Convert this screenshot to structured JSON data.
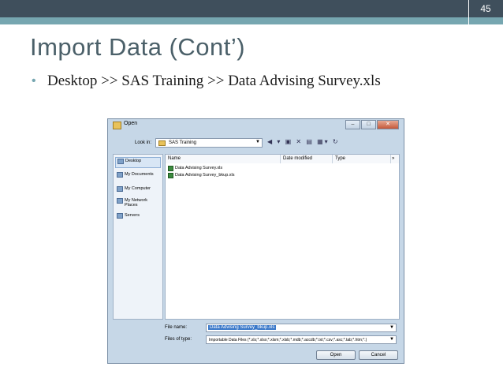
{
  "slide": {
    "page_number": "45",
    "title": "Import Data (Cont’)",
    "bullet": "Desktop >> SAS Training >> Data Advising Survey.xls"
  },
  "dialog": {
    "title": "Open",
    "look_in_label": "Look in:",
    "look_in_value": "SAS Training",
    "places": [
      "Desktop",
      "My Documents",
      "My Computer",
      "My Network Places",
      "Servers"
    ],
    "columns": [
      "Name",
      "Date modified",
      "Type"
    ],
    "files": [
      "Data Advising Survey.xls",
      "Data Advising Survey_bkup.xls"
    ],
    "file_name_label": "File name:",
    "file_name_value": "Data Advising Survey_bkup.xls",
    "files_of_type_label": "Files of type:",
    "files_of_type_value": "Importable Data Files (*.xls;*.xlsx;*.xlsm;*.xlsb;*.mdb;*.accdb;*.txt;*.csv;*.asc;*.tab;*.htm;*.)",
    "open_button": "Open",
    "cancel_button": "Cancel"
  }
}
